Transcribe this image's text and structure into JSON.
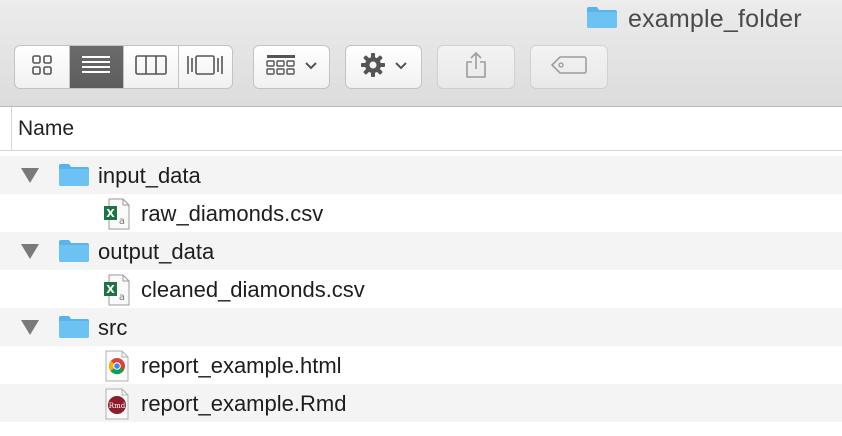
{
  "window": {
    "title": "example_folder",
    "title_icon": "folder-icon"
  },
  "toolbar": {
    "view_modes": [
      {
        "name": "icon-view",
        "icon": "grid-icon",
        "active": false
      },
      {
        "name": "list-view",
        "icon": "list-icon",
        "active": true
      },
      {
        "name": "column-view",
        "icon": "columns-icon",
        "active": false
      },
      {
        "name": "gallery-view",
        "icon": "gallery-icon",
        "active": false
      }
    ],
    "arrange": {
      "icon": "arrange-grid-icon",
      "dropdown": true
    },
    "action": {
      "icon": "gear-icon",
      "dropdown": true
    },
    "share": {
      "icon": "share-icon",
      "enabled": false
    },
    "tags": {
      "icon": "tag-icon",
      "enabled": false
    }
  },
  "columns": {
    "name": "Name"
  },
  "items": [
    {
      "type": "folder",
      "label": "input_data",
      "expanded": true,
      "icon": "folder-icon"
    },
    {
      "type": "file",
      "label": "raw_diamonds.csv",
      "icon": "excel-csv-icon"
    },
    {
      "type": "folder",
      "label": "output_data",
      "expanded": true,
      "icon": "folder-icon"
    },
    {
      "type": "file",
      "label": "cleaned_diamonds.csv",
      "icon": "excel-csv-icon"
    },
    {
      "type": "folder",
      "label": "src",
      "expanded": true,
      "icon": "folder-icon"
    },
    {
      "type": "file",
      "label": "report_example.html",
      "icon": "chrome-html-icon"
    },
    {
      "type": "file",
      "label": "report_example.Rmd",
      "icon": "rmd-icon"
    }
  ],
  "colors": {
    "folder": "#6cc3f3",
    "folder_tab": "#58b4ea",
    "excel_green": "#1f7244",
    "active_segment": "#636363",
    "alt_row": "#f4f4f4",
    "rmd_red": "#8b1d2c"
  }
}
